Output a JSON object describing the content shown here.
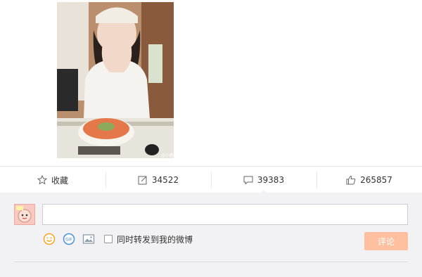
{
  "post": {
    "image_alt": "",
    "watermark": "@小鹿"
  },
  "actions": [
    {
      "icon": "star-icon",
      "label": "收藏"
    },
    {
      "icon": "share-icon",
      "label": "34522"
    },
    {
      "icon": "comment-icon",
      "label": "39383"
    },
    {
      "icon": "like-icon",
      "label": "265857"
    }
  ],
  "comment_box": {
    "value": "",
    "placeholder": "",
    "forward_label": "同时转发到我的微博",
    "submit_label": "评论",
    "tools": [
      "emoji-icon",
      "gif-icon",
      "image-icon"
    ]
  },
  "colors": {
    "submit_bg": "#ffc09f",
    "panel_bg": "#f2f2f5",
    "emoji_orange": "#f5a623",
    "gif_blue": "#4a90d9"
  }
}
